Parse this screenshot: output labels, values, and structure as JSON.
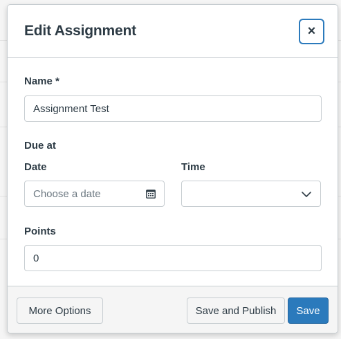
{
  "dialog": {
    "title": "Edit Assignment",
    "close_label": "×"
  },
  "form": {
    "name_label": "Name *",
    "name_value": "Assignment Test",
    "due_label": "Due at",
    "date_label": "Date",
    "date_placeholder": "Choose a date",
    "time_label": "Time",
    "time_value": "",
    "points_label": "Points",
    "points_value": "0"
  },
  "footer": {
    "more_options_label": "More Options",
    "save_publish_label": "Save and Publish",
    "save_label": "Save"
  },
  "colors": {
    "accent": "#2b7abc",
    "text": "#2d3b45",
    "border": "#c7cdd1",
    "footer_bg": "#f5f5f5"
  }
}
